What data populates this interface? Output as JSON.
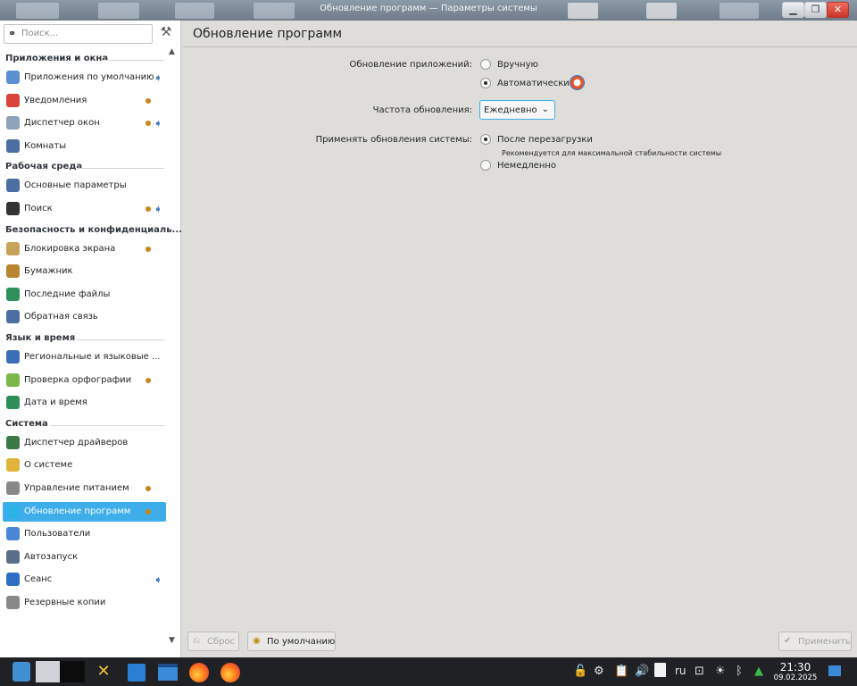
{
  "window": {
    "title": "Обновление программ — Параметры системы",
    "minimize_icon": "minimize-icon",
    "maximize_icon": "maximize-icon",
    "close_icon": "close-icon"
  },
  "sidebar": {
    "search_placeholder": "Поиск...",
    "categories": [
      {
        "label": "Приложения и окна",
        "items": [
          {
            "label": "Приложения по умолчанию",
            "icon": "default-apps-icon",
            "arrow": true
          },
          {
            "label": "Уведомления",
            "icon": "notifications-icon",
            "dot": true
          },
          {
            "label": "Диспетчер окон",
            "icon": "window-manager-icon",
            "dot": true,
            "arrow": true
          },
          {
            "label": "Комнаты",
            "icon": "activities-icon"
          }
        ]
      },
      {
        "label": "Рабочая среда",
        "items": [
          {
            "label": "Основные параметры",
            "icon": "workspace-icon"
          },
          {
            "label": "Поиск",
            "icon": "binoculars-icon",
            "dot": true,
            "arrow": true
          }
        ]
      },
      {
        "label": "Безопасность и конфиденциаль...",
        "items": [
          {
            "label": "Блокировка экрана",
            "icon": "screen-lock-icon",
            "dot": true
          },
          {
            "label": "Бумажник",
            "icon": "wallet-icon"
          },
          {
            "label": "Последние файлы",
            "icon": "recent-files-icon"
          },
          {
            "label": "Обратная связь",
            "icon": "feedback-icon"
          }
        ]
      },
      {
        "label": "Язык и время",
        "items": [
          {
            "label": "Региональные и языковые ...",
            "icon": "regional-icon"
          },
          {
            "label": "Проверка орфографии",
            "icon": "spellcheck-icon",
            "dot": true
          },
          {
            "label": "Дата и время",
            "icon": "clock-icon"
          }
        ]
      },
      {
        "label": "Система",
        "items": [
          {
            "label": "Диспетчер драйверов",
            "icon": "drivers-icon"
          },
          {
            "label": "О системе",
            "icon": "about-icon"
          },
          {
            "label": "Управление питанием",
            "icon": "power-icon",
            "dot": true
          },
          {
            "label": "Обновление программ",
            "icon": "updates-icon",
            "dot": true,
            "active": true
          },
          {
            "label": "Пользователи",
            "icon": "users-icon"
          },
          {
            "label": "Автозапуск",
            "icon": "autostart-icon"
          },
          {
            "label": "Сеанс",
            "icon": "session-icon",
            "arrow": true
          },
          {
            "label": "Резервные копии",
            "icon": "backup-icon"
          }
        ]
      }
    ]
  },
  "main": {
    "title": "Обновление программ",
    "app_updates_label": "Обновление приложений:",
    "manual_label": "Вручную",
    "auto_label": "Автоматически",
    "frequency_label": "Частота обновления:",
    "frequency_value": "Ежедневно",
    "system_updates_label": "Применять обновления системы:",
    "after_reboot_label": "После перезагрузки",
    "after_reboot_note": "Рекомендуется для максимальной стабильности системы",
    "immediately_label": "Немедленно",
    "reset_button": "Сброс",
    "defaults_button": "По умолчанию",
    "apply_button": "Применить"
  },
  "taskbar": {
    "language": "ru",
    "time": "21:30",
    "date": "09.02.2025"
  },
  "colors": {
    "accent": "#3daee9",
    "dot": "#c9861a",
    "taskbar": "#1f2124"
  }
}
